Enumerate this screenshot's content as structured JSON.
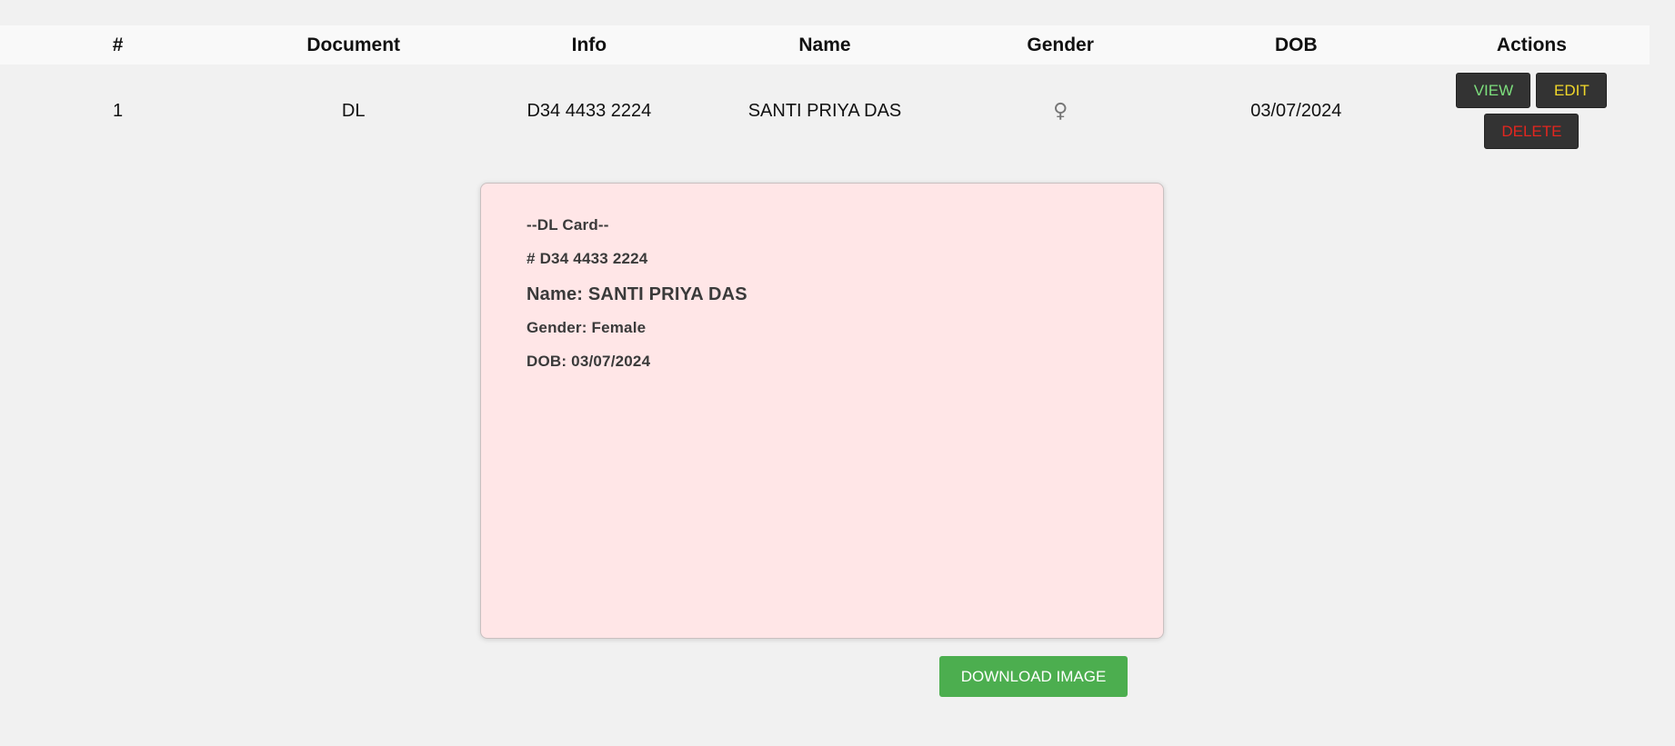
{
  "table": {
    "headers": [
      "#",
      "Document",
      "Info",
      "Name",
      "Gender",
      "DOB",
      "Actions"
    ],
    "rows": [
      {
        "index": "1",
        "document": "DL",
        "info": "D34 4433 2224",
        "name": "SANTI PRIYA DAS",
        "gender_symbol": "♀",
        "dob": "03/07/2024",
        "actions": {
          "view": "VIEW",
          "edit": "EDIT",
          "delete": "DELETE"
        }
      }
    ]
  },
  "card": {
    "title": "--DL Card--",
    "number_line": "# D34 4433 2224",
    "name_line": "Name: SANTI PRIYA DAS",
    "gender_line": "Gender: Female",
    "dob_line": "DOB: 03/07/2024",
    "background_color": "#ffe6e7"
  },
  "download": {
    "label": "DOWNLOAD IMAGE",
    "color": "#4cae4f"
  },
  "colors": {
    "view_text": "#7ddf7d",
    "edit_text": "#f1d72a",
    "delete_text": "#e3261f",
    "button_bg": "#333333"
  }
}
